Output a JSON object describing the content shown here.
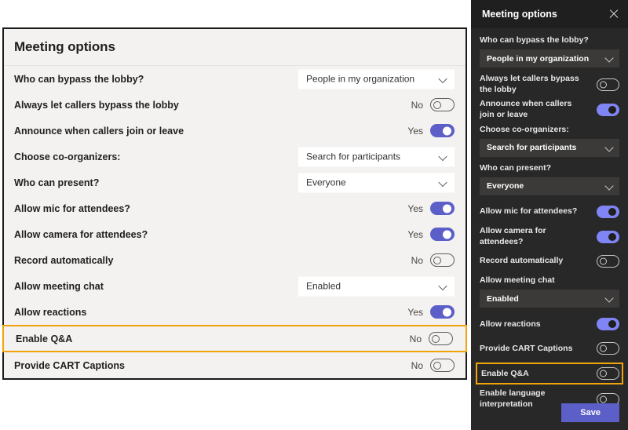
{
  "light_panel": {
    "title": "Meeting options",
    "rows": [
      {
        "label": "Who can bypass the lobby?",
        "control": "dropdown",
        "value": "People in my organization"
      },
      {
        "label": "Always let callers bypass the lobby",
        "control": "toggle",
        "state": "No",
        "on": false
      },
      {
        "label": "Announce when callers join or leave",
        "control": "toggle",
        "state": "Yes",
        "on": true
      },
      {
        "label": "Choose co-organizers:",
        "control": "dropdown",
        "value": "Search for participants"
      },
      {
        "label": "Who can present?",
        "control": "dropdown",
        "value": "Everyone"
      },
      {
        "label": "Allow mic for attendees?",
        "control": "toggle",
        "state": "Yes",
        "on": true
      },
      {
        "label": "Allow camera for attendees?",
        "control": "toggle",
        "state": "Yes",
        "on": true
      },
      {
        "label": "Record automatically",
        "control": "toggle",
        "state": "No",
        "on": false
      },
      {
        "label": "Allow meeting chat",
        "control": "dropdown",
        "value": "Enabled"
      },
      {
        "label": "Allow reactions",
        "control": "toggle",
        "state": "Yes",
        "on": true
      },
      {
        "label": "Enable Q&A",
        "control": "toggle",
        "state": "No",
        "on": false,
        "highlighted": true
      },
      {
        "label": "Provide CART Captions",
        "control": "toggle",
        "state": "No",
        "on": false
      }
    ]
  },
  "dark_panel": {
    "title": "Meeting options",
    "close_icon": "close-icon",
    "items": [
      {
        "kind": "dropdown",
        "caption": "Who can bypass the lobby?",
        "value": "People in my organization"
      },
      {
        "kind": "toggle",
        "label": "Always let callers bypass the lobby",
        "on": false
      },
      {
        "kind": "toggle",
        "label": "Announce when callers join or leave",
        "on": true
      },
      {
        "kind": "dropdown",
        "caption": "Choose co-organizers:",
        "value": "Search for participants"
      },
      {
        "kind": "dropdown",
        "caption": "Who can present?",
        "value": "Everyone"
      },
      {
        "kind": "toggle",
        "label": "Allow mic for attendees?",
        "on": true
      },
      {
        "kind": "toggle",
        "label": "Allow camera for attendees?",
        "on": true
      },
      {
        "kind": "toggle",
        "label": "Record automatically",
        "on": false
      },
      {
        "kind": "dropdown",
        "caption": "Allow meeting chat",
        "value": "Enabled"
      },
      {
        "kind": "toggle",
        "label": "Allow reactions",
        "on": true
      },
      {
        "kind": "toggle",
        "label": "Provide CART Captions",
        "on": false
      },
      {
        "kind": "toggle",
        "label": "Enable Q&A",
        "on": false,
        "highlighted": true
      },
      {
        "kind": "toggle",
        "label": "Enable language interpretation",
        "on": false
      }
    ],
    "save_label": "Save"
  },
  "colors": {
    "highlight": "#f0a30a",
    "accent_light_panel": "#5b5fc7",
    "accent_dark_panel": "#7f85f5",
    "save_button": "#5b5fc7",
    "light_panel_bg": "#f3f2f1",
    "dark_panel_bg": "#292828",
    "dark_header_bg": "#201f1f"
  }
}
